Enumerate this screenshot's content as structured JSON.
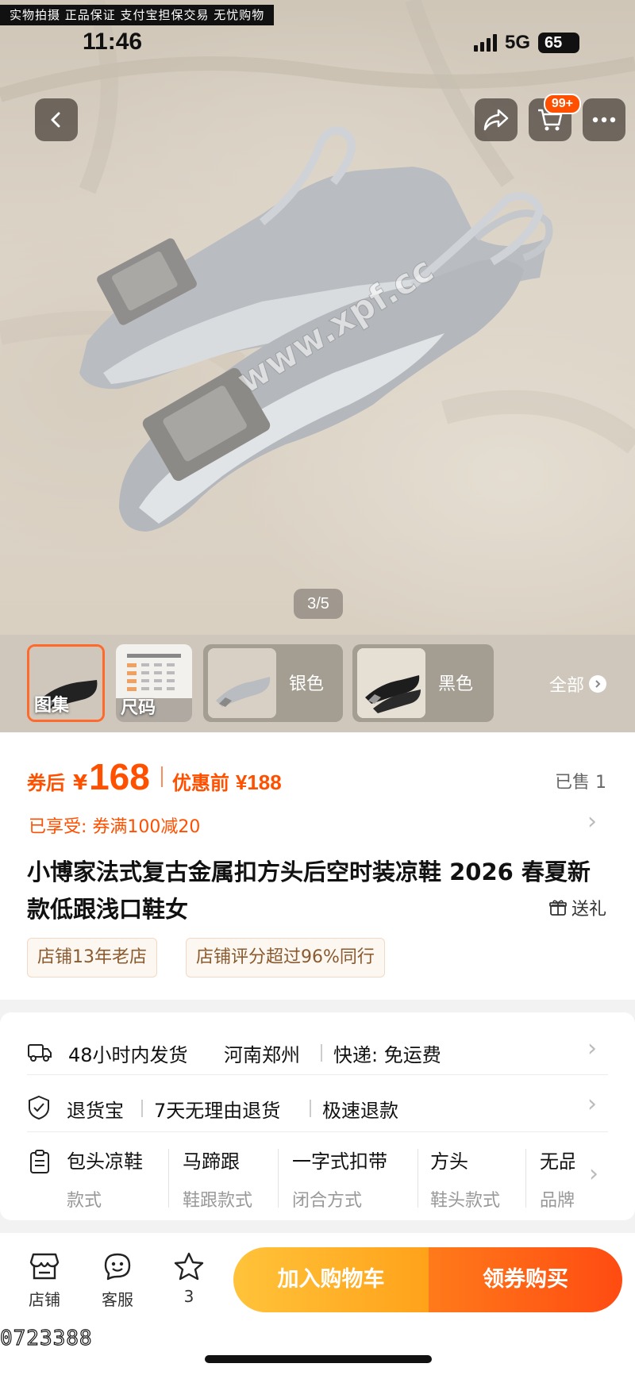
{
  "watermark_banner": "实物拍摄 正品保证 支付宝担保交易 无忧购物",
  "status_bar": {
    "time": "11:46",
    "network": "5G",
    "battery": "65"
  },
  "image_watermark": "www.xpf.cc",
  "nav": {
    "cart_badge": "99+"
  },
  "gallery": {
    "page_indicator": "3/5",
    "current": 3,
    "total": 5
  },
  "variants": {
    "items": [
      {
        "label": "图集",
        "selected": true
      },
      {
        "label": "尺码",
        "selected": false
      },
      {
        "label": "银色",
        "selected": false
      },
      {
        "label": "黑色",
        "selected": false
      }
    ],
    "all_label": "全部"
  },
  "price": {
    "after_coupon_label": "券后",
    "currency": "¥",
    "after_coupon_value": "168",
    "before_label": "优惠前",
    "before_value": "¥188",
    "sold": "已售 1"
  },
  "coupon": {
    "text": "已享受:  券满100减20"
  },
  "product": {
    "title": "小博家法式复古金属扣方头后空时装凉鞋 2026 春夏新款低跟浅口鞋女",
    "gift_label": "送礼"
  },
  "tags": [
    "店铺13年老店",
    "店铺评分超过96%同行"
  ],
  "shipping": {
    "highlight": "48小时内发货",
    "location": "河南郑州",
    "express": "快递: 免运费"
  },
  "returns": {
    "highlight": "退货宝",
    "policy": "7天无理由退货",
    "refund": "极速退款"
  },
  "attributes": [
    {
      "value": "包头凉鞋",
      "key": "款式"
    },
    {
      "value": "马蹄跟",
      "key": "鞋跟款式"
    },
    {
      "value": "一字式扣带",
      "key": "闭合方式"
    },
    {
      "value": "方头",
      "key": "鞋头款式"
    },
    {
      "value": "无品",
      "key": "品牌"
    }
  ],
  "bottom_bar": {
    "store_label": "店铺",
    "service_label": "客服",
    "favorite_count": "3",
    "add_to_cart": "加入购物车",
    "buy": "领券购买"
  },
  "corner_code": "0723388",
  "colors": {
    "accent": "#ff5000",
    "green": "#2aa855",
    "cart_button": "#ffb02a",
    "buy_button": "#ff5a14"
  }
}
